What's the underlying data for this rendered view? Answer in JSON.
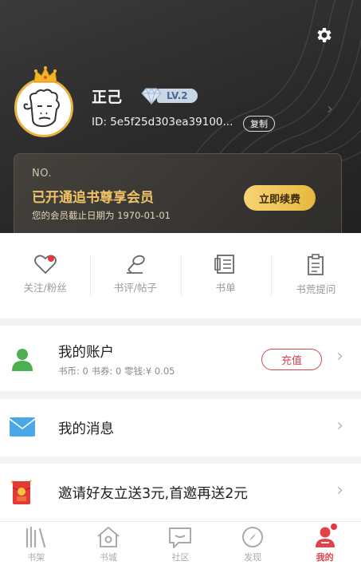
{
  "header": {
    "username": "正己",
    "level": "LV.2",
    "user_id": "ID: 5e5f25d303ea39100...",
    "copy_label": "复制"
  },
  "vip": {
    "no_label": "NO.",
    "title": "已开通追书尊享会员",
    "expiry": "您的会员截止日期为  1970-01-01",
    "renew_label": "立即续费"
  },
  "quick_actions": [
    {
      "label": "关注/粉丝",
      "icon": "heart-icon",
      "badge": true
    },
    {
      "label": "书评/帖子",
      "icon": "microphone-icon",
      "badge": false
    },
    {
      "label": "书单",
      "icon": "booklist-icon",
      "badge": false
    },
    {
      "label": "书荒提问",
      "icon": "clipboard-icon",
      "badge": false
    }
  ],
  "account": {
    "title": "我的账户",
    "details": "书币: 0    书券: 0    零钱:¥ 0.05",
    "recharge_label": "充值"
  },
  "messages": {
    "title": "我的消息"
  },
  "invite": {
    "title": "邀请好友立送3元,首邀再送2元"
  },
  "tabs": [
    {
      "label": "书架",
      "icon": "bookshelf-icon",
      "active": false
    },
    {
      "label": "书城",
      "icon": "bookstore-icon",
      "active": false
    },
    {
      "label": "社区",
      "icon": "community-icon",
      "active": false
    },
    {
      "label": "发现",
      "icon": "discover-icon",
      "active": false
    },
    {
      "label": "我的",
      "icon": "profile-icon",
      "active": true
    }
  ],
  "colors": {
    "accent_red": "#e8363f",
    "gold": "#f0c367",
    "header_bg": "#2e2e2e"
  }
}
